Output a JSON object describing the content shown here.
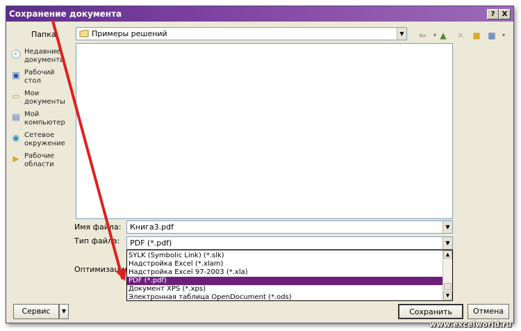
{
  "window": {
    "title": "Сохранение документа",
    "help_button": "?",
    "close_button": "X"
  },
  "folder": {
    "label": "Папка:",
    "current": "Примеры решений"
  },
  "places": [
    {
      "icon": "recent-documents-icon",
      "label": "Недавние документы"
    },
    {
      "icon": "desktop-icon",
      "label": "Рабочий стол"
    },
    {
      "icon": "my-documents-icon",
      "label": "Мои документы"
    },
    {
      "icon": "my-computer-icon",
      "label": "Мой компьютер"
    },
    {
      "icon": "network-icon",
      "label": "Сетевое окружение"
    },
    {
      "icon": "workspaces-icon",
      "label": "Рабочие области"
    }
  ],
  "filename": {
    "label": "Имя файла:",
    "value": "Книга3.pdf"
  },
  "filetype": {
    "label": "Тип файла:",
    "value": "PDF (*.pdf)",
    "options": [
      {
        "label": "SYLK (Symbolic Link) (*.slk)",
        "selected": false
      },
      {
        "label": "Надстройка Excel (*.xlam)",
        "selected": false
      },
      {
        "label": "Надстройка Excel 97-2003 (*.xla)",
        "selected": false
      },
      {
        "label": "PDF (*.pdf)",
        "selected": true
      },
      {
        "label": "Документ XPS (*.xps)",
        "selected": false
      },
      {
        "label": "Электронная таблица OpenDocument (*.ods)",
        "selected": false
      }
    ]
  },
  "optimization": {
    "label": "Оптимизация:"
  },
  "buttons": {
    "service": "Сервис",
    "save": "Сохранить",
    "cancel": "Отмена"
  },
  "watermark": "www.excelworld.ru",
  "colors": {
    "titlebar": "#6a338f",
    "selection": "#6d1f7c",
    "annotation_arrow": "#e01e1e"
  }
}
